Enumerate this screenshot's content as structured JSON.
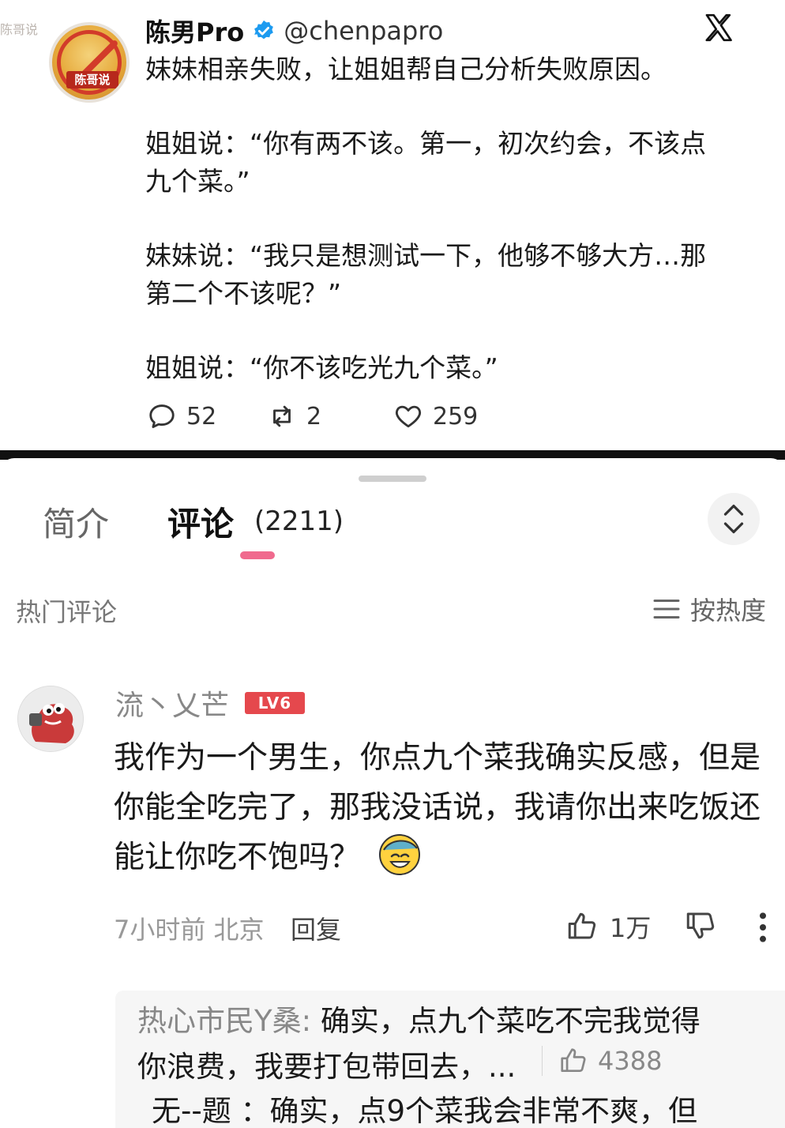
{
  "tweet": {
    "watermark": "陈哥说",
    "avatar_seal": "陈哥说",
    "author_name": "陈男Pro",
    "author_handle": "@chenpapro",
    "paragraphs": [
      "妹妹相亲失败，让姐姐帮自己分析失败原因。",
      "姐姐说：“你有两不该。第一，初次约会，不该点九个菜。”",
      "妹妹说：“我只是想测试一下，他够不够大方…那第二个不该呢？”",
      "姐姐说：“你不该吃光九个菜。”"
    ],
    "replies": "52",
    "retweets": "2",
    "likes": "259"
  },
  "sheet": {
    "tab_intro": "简介",
    "tab_comments": "评论",
    "comment_count": "(2211)",
    "hot_label": "热门评论",
    "sort_label": "按热度"
  },
  "comment": {
    "username": "流丶乂芒",
    "level": "LV6",
    "text": "我作为一个男生，你点九个菜我确实反感，但是你能全吃完了，那我没话说，我请你出来吃饭还能让你吃不饱吗？",
    "meta": "7小时前 北京",
    "reply_label": "回复",
    "likes": "1万"
  },
  "sub_comments": {
    "first_name": "热心市民Y桑:",
    "first_text_line1": " 确实，点九个菜吃不完我觉得",
    "first_text_line2": "你浪费，我要打包带回去，...",
    "first_likes": "4388",
    "second_partial": "无--题 ：确实，点9个菜我会非常不爽，但"
  },
  "colors": {
    "accent_pink": "#f06a8e",
    "level_red": "#e5484d",
    "verified_blue": "#1d9bf0"
  }
}
